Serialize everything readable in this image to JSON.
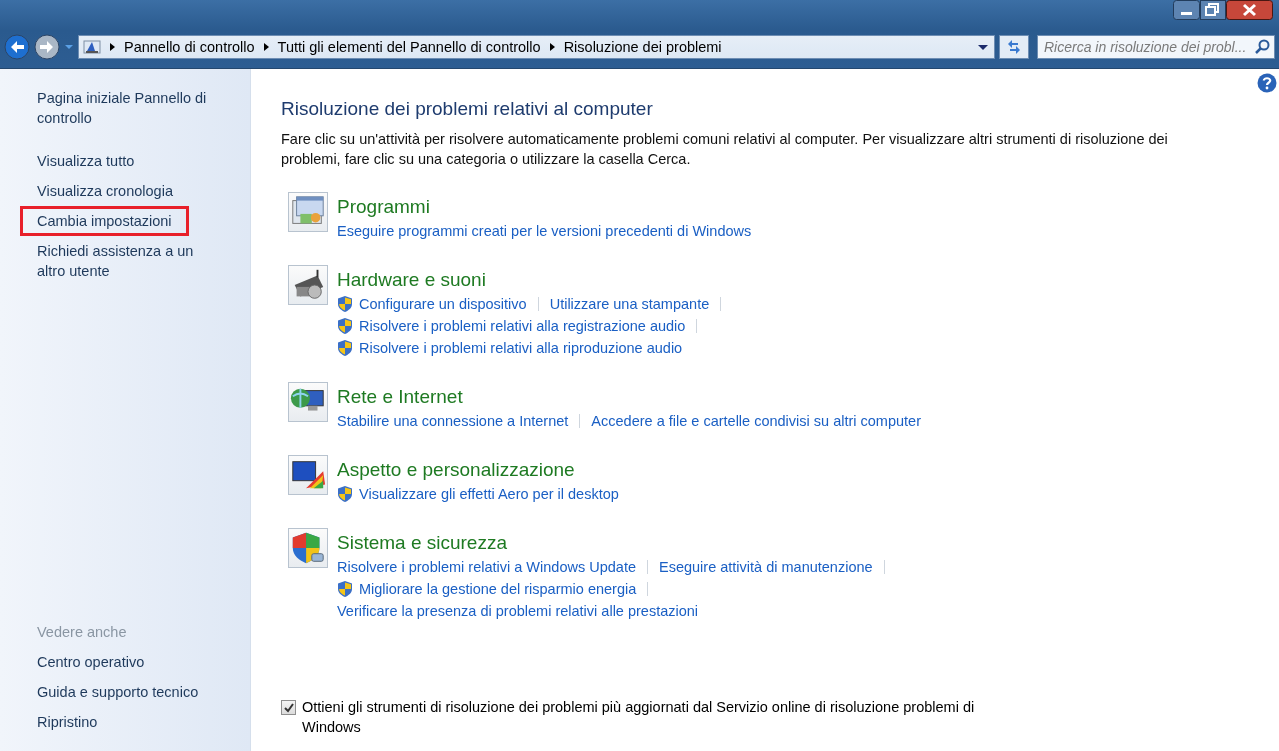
{
  "navigation": {
    "back": {
      "disabled": false
    },
    "forward": {
      "disabled": true
    }
  },
  "breadcrumbs": [
    "Pannello di controllo",
    "Tutti gli elementi del Pannello di controllo",
    "Risoluzione dei problemi"
  ],
  "search": {
    "placeholder": "Ricerca in risoluzione dei probl..."
  },
  "sidebar": {
    "items": [
      {
        "label": "Pagina iniziale Pannello di controllo",
        "highlighted": false
      },
      {
        "label": "Visualizza tutto",
        "highlighted": false
      },
      {
        "label": "Visualizza cronologia",
        "highlighted": false
      },
      {
        "label": "Cambia impostazioni",
        "highlighted": true
      },
      {
        "label": "Richiedi assistenza a un altro utente",
        "highlighted": false
      }
    ],
    "see_also": {
      "heading": "Vedere anche",
      "items": [
        "Centro operativo",
        "Guida e supporto tecnico",
        "Ripristino"
      ]
    }
  },
  "main": {
    "title": "Risoluzione dei problemi relativi al computer",
    "description": "Fare clic su un'attività per risolvere automaticamente problemi comuni relativi al computer. Per visualizzare altri strumenti di risoluzione dei problemi, fare clic su una categoria o utilizzare la casella Cerca.",
    "categories": [
      {
        "kind": "programs",
        "title": "Programmi",
        "rows": [
          [
            {
              "label": "Eseguire programmi creati per le versioni precedenti di Windows",
              "shield": false,
              "separator": false
            }
          ]
        ]
      },
      {
        "kind": "hardware",
        "title": "Hardware e suoni",
        "rows": [
          [
            {
              "label": "Configurare un dispositivo",
              "shield": true,
              "separator": true
            },
            {
              "label": "Utilizzare una stampante",
              "shield": false,
              "separator": true
            }
          ],
          [
            {
              "label": "Risolvere i problemi relativi alla registrazione audio",
              "shield": true,
              "separator": true
            }
          ],
          [
            {
              "label": "Risolvere i problemi relativi alla riproduzione audio",
              "shield": true,
              "separator": false
            }
          ]
        ]
      },
      {
        "kind": "network",
        "title": "Rete e Internet",
        "rows": [
          [
            {
              "label": "Stabilire una connessione a Internet",
              "shield": false,
              "separator": true
            },
            {
              "label": "Accedere a file e cartelle condivisi su altri computer",
              "shield": false,
              "separator": false
            }
          ]
        ]
      },
      {
        "kind": "appearance",
        "title": "Aspetto e personalizzazione",
        "rows": [
          [
            {
              "label": "Visualizzare gli effetti Aero per il desktop",
              "shield": true,
              "separator": false
            }
          ]
        ]
      },
      {
        "kind": "system",
        "title": "Sistema e sicurezza",
        "rows": [
          [
            {
              "label": "Risolvere i problemi relativi a Windows Update",
              "shield": false,
              "separator": true
            },
            {
              "label": "Eseguire attività di manutenzione",
              "shield": false,
              "separator": true
            }
          ],
          [
            {
              "label": "Migliorare la gestione del risparmio energia",
              "shield": true,
              "separator": true
            }
          ],
          [
            {
              "label": "Verificare la presenza di problemi relativi alle prestazioni",
              "shield": false,
              "separator": false
            }
          ]
        ]
      }
    ],
    "online_option": {
      "label": "Ottieni gli strumenti di risoluzione dei problemi più aggiornati dal Servizio online di risoluzione problemi di Windows",
      "checked": true
    }
  }
}
